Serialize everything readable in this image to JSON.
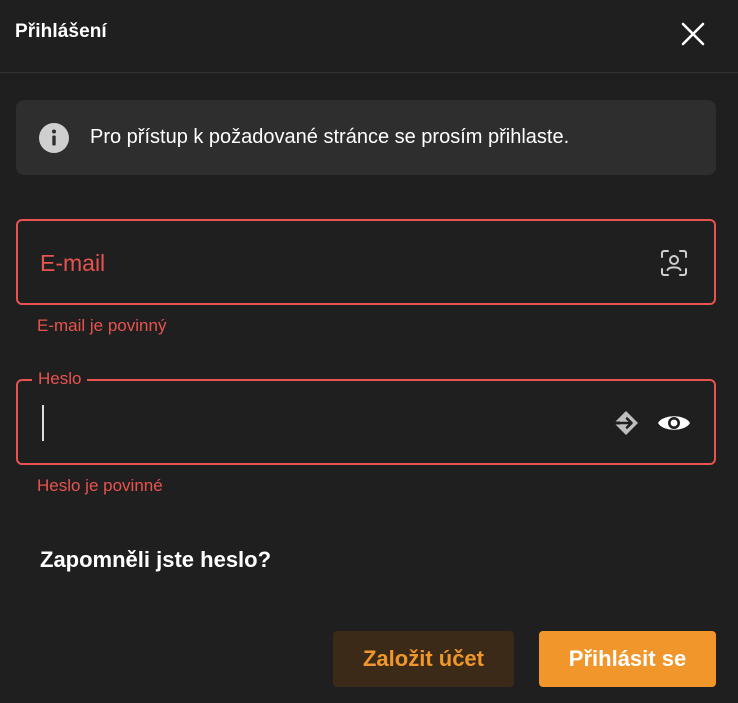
{
  "dialog": {
    "title": "Přihlášení",
    "close_icon": "close-icon"
  },
  "info": {
    "icon": "info-icon",
    "text": "Pro přístup k požadované stránce se prosím přihlaste."
  },
  "email": {
    "placeholder": "E-mail",
    "value": "",
    "icon": "user-scan-icon",
    "error": "E-mail je povinný"
  },
  "password": {
    "label": "Heslo",
    "value": "",
    "autofill_icon": "autofill-arrow-icon",
    "visibility_icon": "eye-icon",
    "error": "Heslo je povinné"
  },
  "forgot_password": "Zapomněli jste heslo?",
  "buttons": {
    "create_account": "Založit účet",
    "login": "Přihlásit se"
  },
  "colors": {
    "background": "#1f1f1f",
    "error": "#e8534f",
    "accent": "#f0962a",
    "info_box": "#2e2e2e"
  }
}
